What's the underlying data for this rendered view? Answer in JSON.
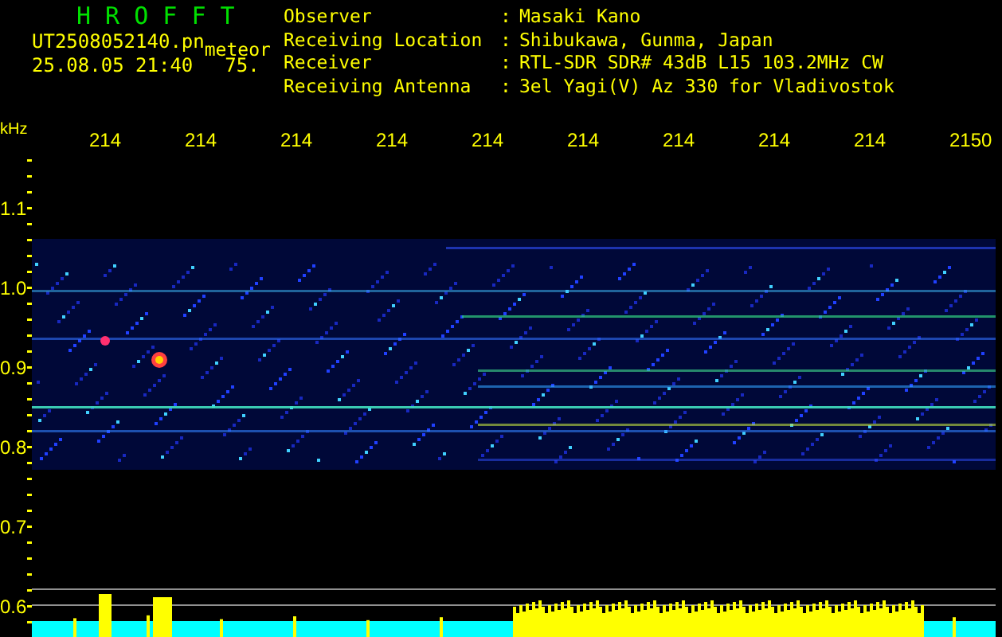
{
  "header": {
    "title": "H R O F F T",
    "filename": "UT2508052140.pn",
    "event_type": "meteor",
    "datetime": "25.08.05 21:40",
    "value": "75.",
    "info": [
      {
        "label": "Observer",
        "separator": ":",
        "value": "Masaki Kano"
      },
      {
        "label": "Receiving Location",
        "separator": ":",
        "value": "Shibukawa, Gunma, Japan"
      },
      {
        "label": "Receiver",
        "separator": ":",
        "value": "RTL-SDR SDR# 43dB L15 103.2MHz CW"
      },
      {
        "label": "Receiving Antenna",
        "separator": ":",
        "value": "3el Yagi(V) Az 330 for Vladivostok"
      }
    ]
  },
  "frequency_axis": {
    "unit": "kHz",
    "labels": [
      "214",
      "214",
      "214",
      "214",
      "214",
      "214",
      "214",
      "214",
      "214",
      "2150"
    ]
  },
  "y_axis": {
    "labels": [
      "1.1",
      "1.0",
      "0.9",
      "0.8",
      "0.7",
      "0.6"
    ]
  }
}
